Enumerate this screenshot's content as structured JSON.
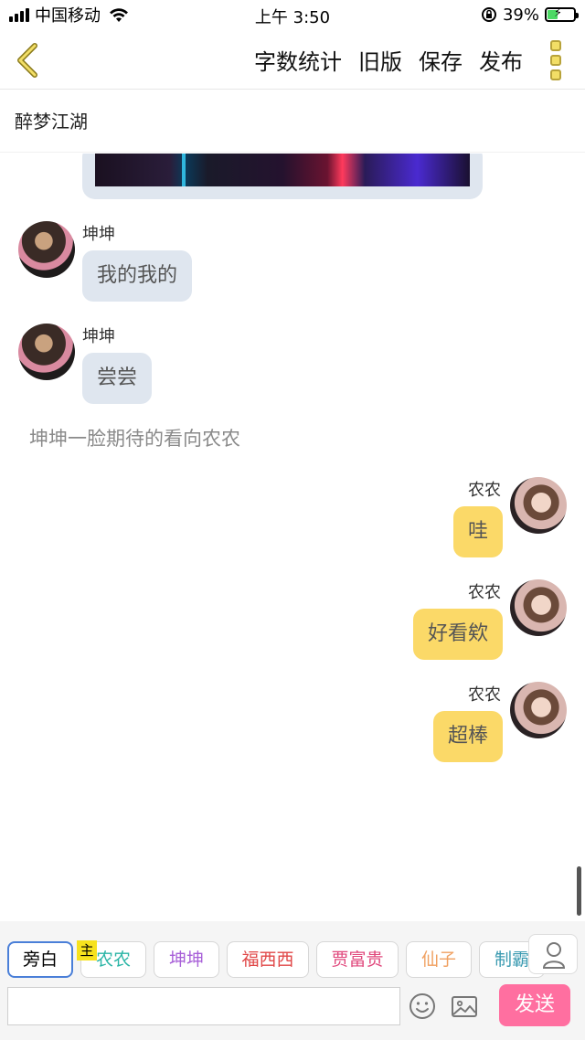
{
  "status_bar": {
    "carrier": "中国移动",
    "time": "上午 3:50",
    "battery": "39%",
    "battery_level": 0.39
  },
  "nav": {
    "actions": [
      "字数统计",
      "旧版",
      "保存",
      "发布"
    ]
  },
  "story": {
    "title": "醉梦江湖"
  },
  "messages": [
    {
      "sender": "坤坤",
      "text": "我的我的"
    },
    {
      "sender": "坤坤",
      "text": "尝尝"
    },
    {
      "sender": "农农",
      "text": "哇"
    },
    {
      "sender": "农农",
      "text": "好看欸"
    },
    {
      "sender": "农农",
      "text": "超棒"
    }
  ],
  "narration": "坤坤一脸期待的看向农农",
  "bottom": {
    "host_badge": "主",
    "roles": [
      {
        "label": "旁白",
        "color": "#000000"
      },
      {
        "label": "农农",
        "color": "#2bb5a6"
      },
      {
        "label": "坤坤",
        "color": "#a860d8"
      },
      {
        "label": "福西西",
        "color": "#e04848"
      },
      {
        "label": "贾富贵",
        "color": "#e0487c"
      },
      {
        "label": "仙子",
        "color": "#f0a060"
      },
      {
        "label": "制霸",
        "color": "#3a9ab0"
      }
    ],
    "send_label": "发送",
    "input_value": ""
  },
  "colors": {
    "left_bubble": "#dfe6ef",
    "right_bubble": "#fbd968",
    "send_button": "#ff6fa0",
    "active_chip_border": "#4a7fd8"
  }
}
